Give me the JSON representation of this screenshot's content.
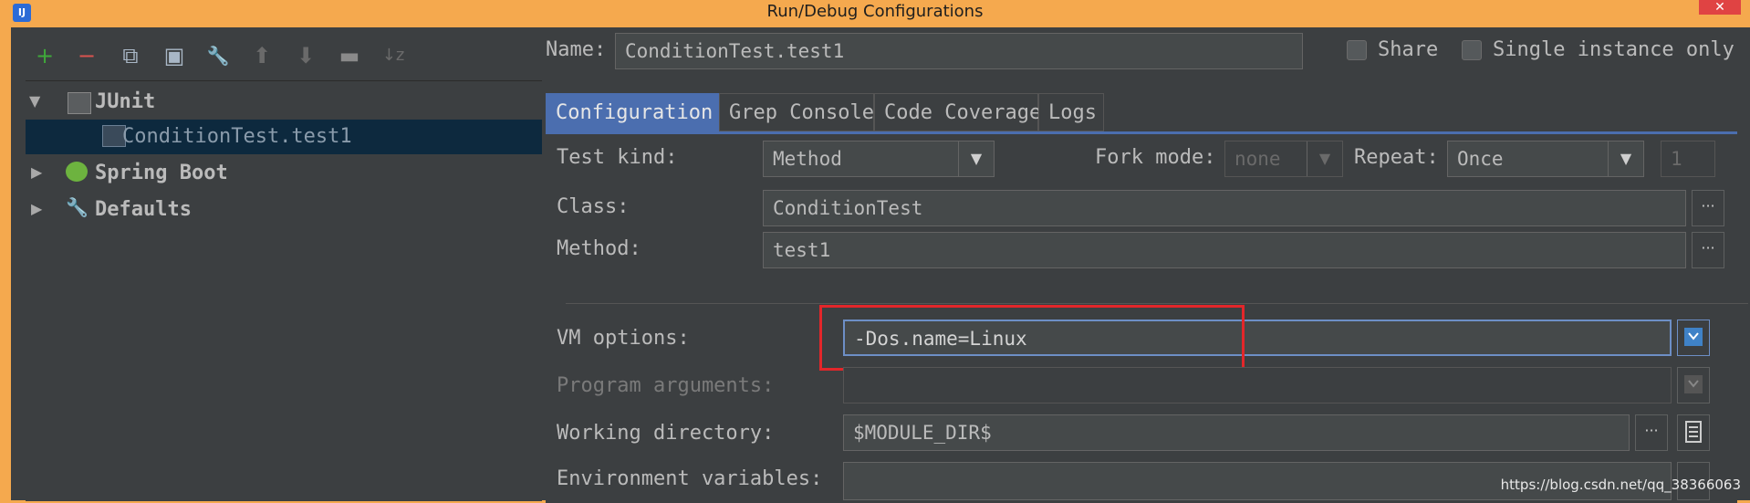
{
  "window": {
    "title": "Run/Debug Configurations",
    "close_glyph": "✕",
    "app_icon_glyph": "IJ"
  },
  "toolbar": {
    "icons": [
      {
        "name": "add-icon",
        "glyph": "+",
        "color": "#3fa83a"
      },
      {
        "name": "remove-icon",
        "glyph": "−",
        "color": "#d9534f"
      },
      {
        "name": "copy-icon",
        "glyph": "⧉",
        "color": "#a9b7c6"
      },
      {
        "name": "save-icon",
        "glyph": "▣",
        "color": "#a9b7c6"
      },
      {
        "name": "wrench-icon",
        "glyph": "🔧",
        "color": "#a9b7c6"
      },
      {
        "name": "move-up-icon",
        "glyph": "⬆",
        "color": "#6a6a6a"
      },
      {
        "name": "move-down-icon",
        "glyph": "⬇",
        "color": "#6a6a6a"
      },
      {
        "name": "folder-icon",
        "glyph": "▬",
        "color": "#8a8a8a"
      },
      {
        "name": "sort-icon",
        "glyph": "↓z",
        "color": "#6a6a6a"
      }
    ]
  },
  "tree": {
    "junit": {
      "label": "JUnit",
      "arrow": "▼"
    },
    "condition_test": {
      "label": "ConditionTest.test1"
    },
    "spring_boot": {
      "label": "Spring Boot",
      "arrow": "▶"
    },
    "defaults": {
      "label": "Defaults",
      "arrow": "▶"
    }
  },
  "header": {
    "name_label": "Name:",
    "name_value": "ConditionTest.test1",
    "share_label": "Share",
    "single_instance_label": "Single instance only"
  },
  "tabs": [
    "Configuration",
    "Grep Console",
    "Code Coverage",
    "Logs"
  ],
  "config": {
    "test_kind_label": "Test kind:",
    "test_kind_value": "Method",
    "fork_mode_label": "Fork mode:",
    "fork_mode_value": "none",
    "repeat_label": "Repeat:",
    "repeat_value": "Once",
    "repeat_count": "1",
    "class_label": "Class:",
    "class_value": "ConditionTest",
    "method_label": "Method:",
    "method_value": "test1",
    "vm_options_label": "VM options:",
    "vm_options_value": "-Dos.name=Linux",
    "program_args_label": "Program arguments:",
    "program_args_value": "",
    "working_dir_label": "Working directory:",
    "working_dir_value": "$MODULE_DIR$",
    "env_vars_label": "Environment variables:",
    "env_vars_value": ""
  },
  "combo_arrow": "▼",
  "dots": "···",
  "watermark": "https://blog.csdn.net/qq_38366063",
  "colors": {
    "title_bar": "#f5a94e",
    "panel_bg": "#3c3f41",
    "selection": "#0d293e",
    "tab_active": "#4b6eaf",
    "highlight_box": "#e3262a"
  }
}
